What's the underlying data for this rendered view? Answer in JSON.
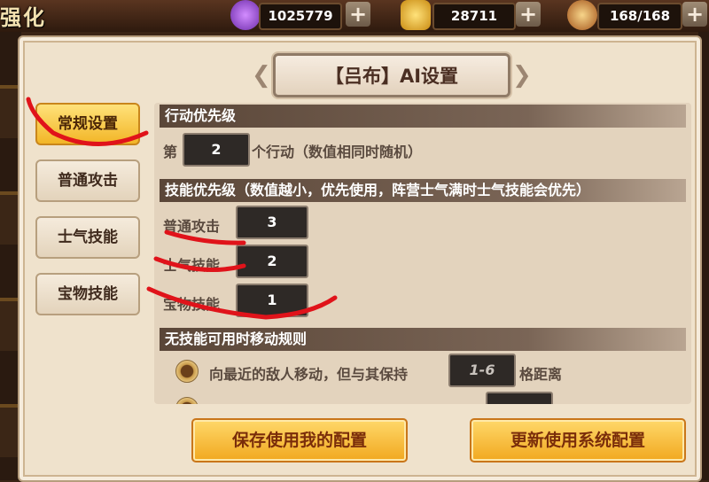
{
  "top": {
    "title": "强化",
    "resources": [
      {
        "icon": "purple-orb-icon",
        "value": "1025779"
      },
      {
        "icon": "gold-ingot-icon",
        "value": "28711"
      },
      {
        "icon": "stamina-chicken-icon",
        "value": "168/168"
      }
    ],
    "plus": "+"
  },
  "dialog": {
    "title": "【吕布】AI设置",
    "tabs": [
      "常规设置",
      "普通攻击",
      "士气技能",
      "宝物技能"
    ],
    "action_section": {
      "header": "行动优先级",
      "prefix": "第",
      "value": "2",
      "suffix": "个行动（数值相同时随机）"
    },
    "skill_section": {
      "header": "技能优先级（数值越小，优先使用，阵营士气满时士气技能会优先）",
      "rows": [
        {
          "label": "普通攻击",
          "value": "3"
        },
        {
          "label": "士气技能",
          "value": "2"
        },
        {
          "label": "宝物技能",
          "value": "1"
        }
      ]
    },
    "move_section": {
      "header": "无技能可用时移动规则",
      "option_text": "向最近的敌人移动，但与其保持",
      "range": "1-6",
      "unit": "格距离"
    },
    "buttons": {
      "save": "保存使用我的配置",
      "update": "更新使用系统配置"
    }
  },
  "colors": {
    "tab_active": "#f2b627",
    "annotation": "#e0131a",
    "panel_bg": "#efe2cc"
  }
}
